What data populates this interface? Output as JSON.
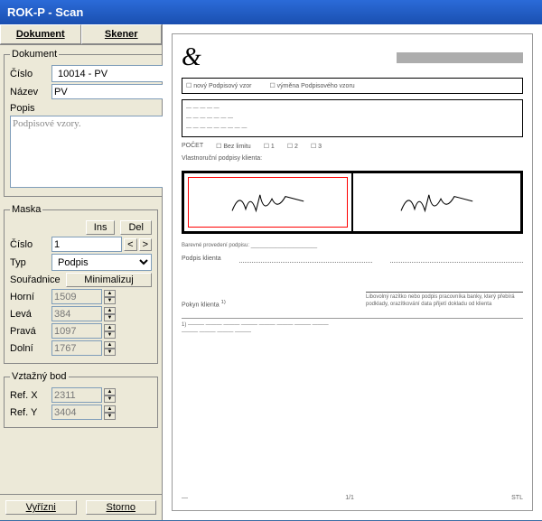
{
  "window": {
    "title": "ROK-P - Scan"
  },
  "toolbar": {
    "dokument": "Dokument",
    "skener": "Skener"
  },
  "dokument": {
    "legend": "Dokument",
    "cislo_label": "Číslo",
    "cislo_value": "10014 - PV",
    "nazev_label": "Název",
    "nazev_value": "PV",
    "popis_label": "Popis",
    "popis_value": "Podpisové vzory."
  },
  "maska": {
    "legend": "Maska",
    "ins": "Ins",
    "del": "Del",
    "cislo_label": "Číslo",
    "cislo_value": "1",
    "typ_label": "Typ",
    "typ_value": "Podpis",
    "sour_label": "Souřadnice",
    "minimalizuj": "Minimalizuj",
    "horni_label": "Horní",
    "horni_value": "1509",
    "leva_label": "Levá",
    "leva_value": "384",
    "prava_label": "Pravá",
    "prava_value": "1097",
    "dolni_label": "Dolní",
    "dolni_value": "1767"
  },
  "vztazny": {
    "legend": "Vztažný bod",
    "refx_label": "Ref. X",
    "refx_value": "2311",
    "refy_label": "Ref. Y",
    "refy_value": "3404"
  },
  "buttons": {
    "vyrizni": "Vyřízni",
    "storno": "Storno"
  },
  "doc": {
    "opt1": "nový Podpisový vzor",
    "opt2": "výměna Podpisového vzoru",
    "sec_label": "Vlastnoruční podpisy klienta:",
    "pocet_label": "POČET",
    "bez_label": "Bez limitu",
    "barva_label": "Barevné provedení podpisu",
    "podpis_label": "Podpis klienta",
    "note_label": "Pokyn klienta",
    "note_text": "Libovolný razítko nebo podpis pracovníka banky, který přebírá  podklady, orazítkování data přijetí dokladu od klienta",
    "ftr_page": "1/1",
    "ftr_code": "STL"
  }
}
